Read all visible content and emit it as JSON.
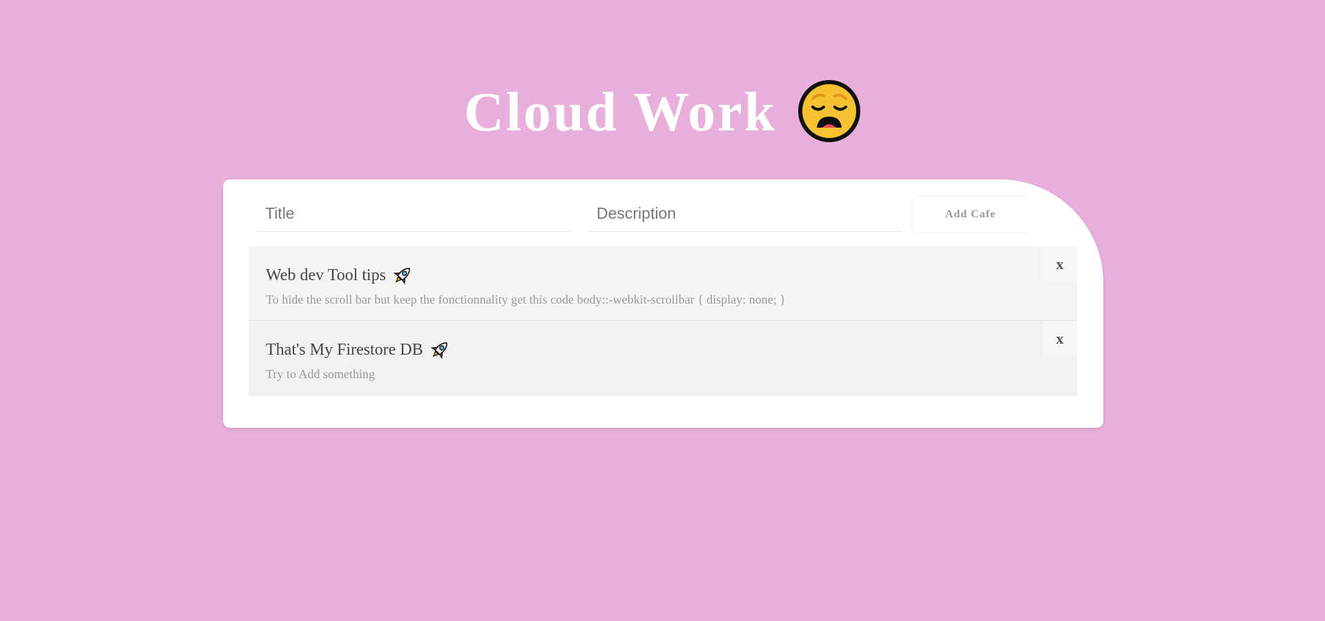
{
  "header": {
    "title": "Cloud Work",
    "emoji": "weary-face-icon"
  },
  "form": {
    "title_placeholder": "Title",
    "title_value": "",
    "description_placeholder": "Description",
    "description_value": "",
    "add_button_label": "Add Cafe"
  },
  "items": [
    {
      "title": "Web dev Tool tips",
      "icon": "rocket-icon",
      "description": "To hide the scroll bar but keep the fonctionnality get this code body::-webkit-scrollbar { display: none; }",
      "delete_label": "x"
    },
    {
      "title": "That's My Firestore DB",
      "icon": "rocket-icon",
      "description": "Try to Add something",
      "delete_label": "x"
    }
  ],
  "colors": {
    "background": "#e8afdb",
    "card": "#ffffff",
    "title_text": "#ffffff",
    "item_bg_odd": "#f4f4f4",
    "item_bg_even": "#f1f1f1"
  }
}
